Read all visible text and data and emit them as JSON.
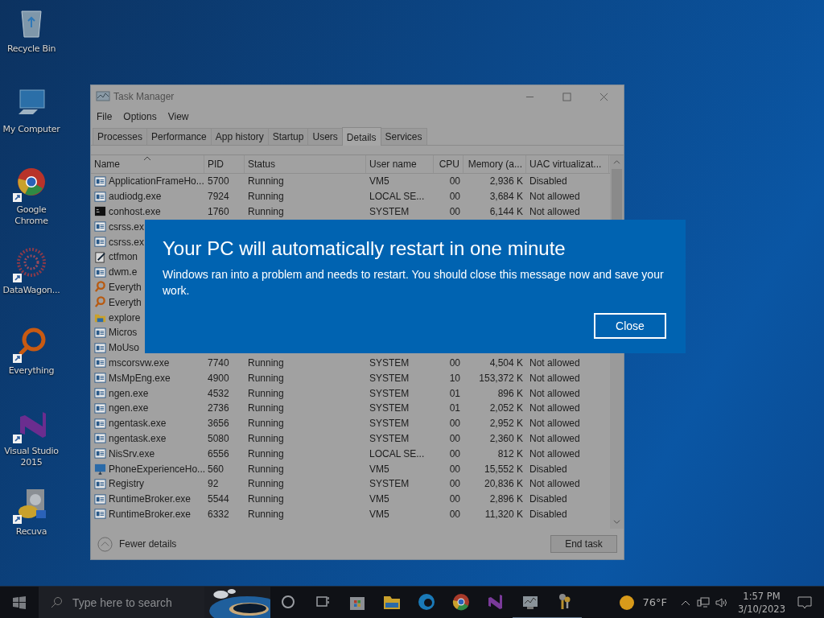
{
  "desktop_icons": [
    {
      "label": "Recycle Bin",
      "kind": "recycle",
      "shortcut": false
    },
    {
      "label": "My Computer",
      "kind": "computer",
      "shortcut": false
    },
    {
      "label": "Google Chrome",
      "kind": "chrome",
      "shortcut": true
    },
    {
      "label": "DataWagon...",
      "kind": "burst",
      "shortcut": true
    },
    {
      "label": "Everything",
      "kind": "everything",
      "shortcut": true
    },
    {
      "label": "Visual Studio 2015",
      "kind": "vs",
      "shortcut": true
    },
    {
      "label": "Recuva",
      "kind": "recuva",
      "shortcut": true
    }
  ],
  "task_manager": {
    "title": "Task Manager",
    "menu": [
      "File",
      "Options",
      "View"
    ],
    "tabs": [
      {
        "label": "Processes",
        "selected": false
      },
      {
        "label": "Performance",
        "selected": false
      },
      {
        "label": "App history",
        "selected": false
      },
      {
        "label": "Startup",
        "selected": false
      },
      {
        "label": "Users",
        "selected": false
      },
      {
        "label": "Details",
        "selected": true
      },
      {
        "label": "Services",
        "selected": false
      }
    ],
    "columns": [
      {
        "label": "Name",
        "sorted": true
      },
      {
        "label": "PID",
        "sorted": false
      },
      {
        "label": "Status",
        "sorted": false
      },
      {
        "label": "User name",
        "sorted": false
      },
      {
        "label": "CPU",
        "sorted": false
      },
      {
        "label": "Memory (a...",
        "sorted": false
      },
      {
        "label": "UAC virtualizat...",
        "sorted": false
      }
    ],
    "rows": [
      {
        "kind": "app",
        "cells": [
          "ApplicationFrameHo...",
          "5700",
          "Running",
          "VM5",
          "00",
          "2,936 K",
          "Disabled"
        ]
      },
      {
        "kind": "app",
        "cells": [
          "audiodg.exe",
          "7924",
          "Running",
          "LOCAL SE...",
          "00",
          "3,684 K",
          "Not allowed"
        ]
      },
      {
        "kind": "console",
        "cells": [
          "conhost.exe",
          "1760",
          "Running",
          "SYSTEM",
          "00",
          "6,144 K",
          "Not allowed"
        ]
      },
      {
        "kind": "app",
        "cells": [
          "csrss.ex"
        ]
      },
      {
        "kind": "app",
        "cells": [
          "csrss.ex"
        ]
      },
      {
        "kind": "notepad",
        "cells": [
          "ctfmon"
        ]
      },
      {
        "kind": "app",
        "cells": [
          "dwm.e"
        ]
      },
      {
        "kind": "search",
        "cells": [
          "Everyth"
        ]
      },
      {
        "kind": "search",
        "cells": [
          "Everyth"
        ]
      },
      {
        "kind": "folder",
        "cells": [
          "explore"
        ]
      },
      {
        "kind": "app",
        "cells": [
          "Micros"
        ]
      },
      {
        "kind": "app",
        "cells": [
          "MoUso"
        ]
      },
      {
        "kind": "app",
        "cells": [
          "mscorsvw.exe",
          "7740",
          "Running",
          "SYSTEM",
          "00",
          "4,504 K",
          "Not allowed"
        ]
      },
      {
        "kind": "app",
        "cells": [
          "MsMpEng.exe",
          "4900",
          "Running",
          "SYSTEM",
          "10",
          "153,372 K",
          "Not allowed"
        ]
      },
      {
        "kind": "app",
        "cells": [
          "ngen.exe",
          "4532",
          "Running",
          "SYSTEM",
          "01",
          "896 K",
          "Not allowed"
        ]
      },
      {
        "kind": "app",
        "cells": [
          "ngen.exe",
          "2736",
          "Running",
          "SYSTEM",
          "01",
          "2,052 K",
          "Not allowed"
        ]
      },
      {
        "kind": "app",
        "cells": [
          "ngentask.exe",
          "3656",
          "Running",
          "SYSTEM",
          "00",
          "2,952 K",
          "Not allowed"
        ]
      },
      {
        "kind": "app",
        "cells": [
          "ngentask.exe",
          "5080",
          "Running",
          "SYSTEM",
          "00",
          "2,360 K",
          "Not allowed"
        ]
      },
      {
        "kind": "app",
        "cells": [
          "NisSrv.exe",
          "6556",
          "Running",
          "LOCAL SE...",
          "00",
          "812 K",
          "Not allowed"
        ]
      },
      {
        "kind": "monitor",
        "cells": [
          "PhoneExperienceHo...",
          "560",
          "Running",
          "VM5",
          "00",
          "15,552 K",
          "Disabled"
        ]
      },
      {
        "kind": "app",
        "cells": [
          "Registry",
          "92",
          "Running",
          "SYSTEM",
          "00",
          "20,836 K",
          "Not allowed"
        ]
      },
      {
        "kind": "app",
        "cells": [
          "RuntimeBroker.exe",
          "5544",
          "Running",
          "VM5",
          "00",
          "2,896 K",
          "Disabled"
        ]
      },
      {
        "kind": "app",
        "cells": [
          "RuntimeBroker.exe",
          "6332",
          "Running",
          "VM5",
          "00",
          "11,320 K",
          "Disabled"
        ]
      }
    ],
    "fewer_details": "Fewer details",
    "end_task": "End task"
  },
  "dialog": {
    "title": "Your PC will automatically restart in one minute",
    "message": "Windows ran into a problem and needs to restart. You should close this message now and save your work.",
    "button": "Close"
  },
  "taskbar": {
    "search_placeholder": "Type here to search",
    "apps": [
      {
        "kind": "cortana",
        "running": false
      },
      {
        "kind": "taskview",
        "running": false
      },
      {
        "kind": "store",
        "running": false
      },
      {
        "kind": "folder",
        "running": false
      },
      {
        "kind": "edge",
        "running": false
      },
      {
        "kind": "chrome",
        "running": false
      },
      {
        "kind": "vs",
        "running": false
      },
      {
        "kind": "taskmgr",
        "running": true
      },
      {
        "kind": "keys",
        "running": true
      }
    ],
    "temperature": "76°F",
    "time": "1:57 PM",
    "date": "3/10/2023"
  }
}
